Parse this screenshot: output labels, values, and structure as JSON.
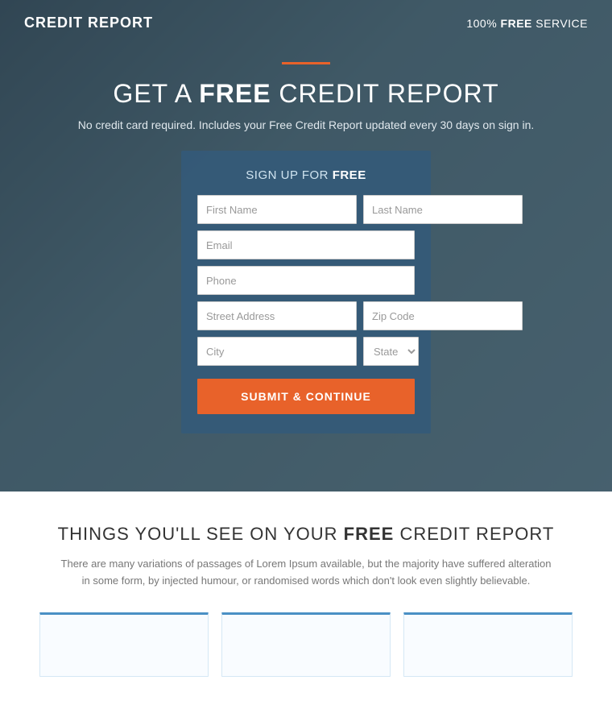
{
  "header": {
    "brand": "CREDIT REPORT",
    "service_badge": "100% ",
    "service_badge_strong": "FREE",
    "service_badge_suffix": " SERVICE"
  },
  "hero": {
    "divider_color": "#e8622a",
    "title_prefix": "GET A ",
    "title_strong": "FREE",
    "title_suffix": " CREDIT REPORT",
    "subtitle": "No credit card required. Includes your Free Credit Report updated every 30 days on sign in."
  },
  "form": {
    "title_prefix": "SIGN UP FOR ",
    "title_strong": "FREE",
    "first_name_placeholder": "First Name",
    "last_name_placeholder": "Last Name",
    "email_placeholder": "Email",
    "phone_placeholder": "Phone",
    "street_placeholder": "Street Address",
    "zip_placeholder": "Zip Code",
    "city_placeholder": "City",
    "state_placeholder": "State",
    "submit_label": "SUBMIT & CONTINUE"
  },
  "bottom": {
    "title_prefix": "THINGS YOU'LL SEE ON YOUR ",
    "title_strong": "FREE",
    "title_suffix": " CREDIT REPORT",
    "description": "There are many variations of passages of Lorem Ipsum available, but the majority have suffered alteration in some form, by injected humour, or randomised words which don't look even slightly believable."
  }
}
